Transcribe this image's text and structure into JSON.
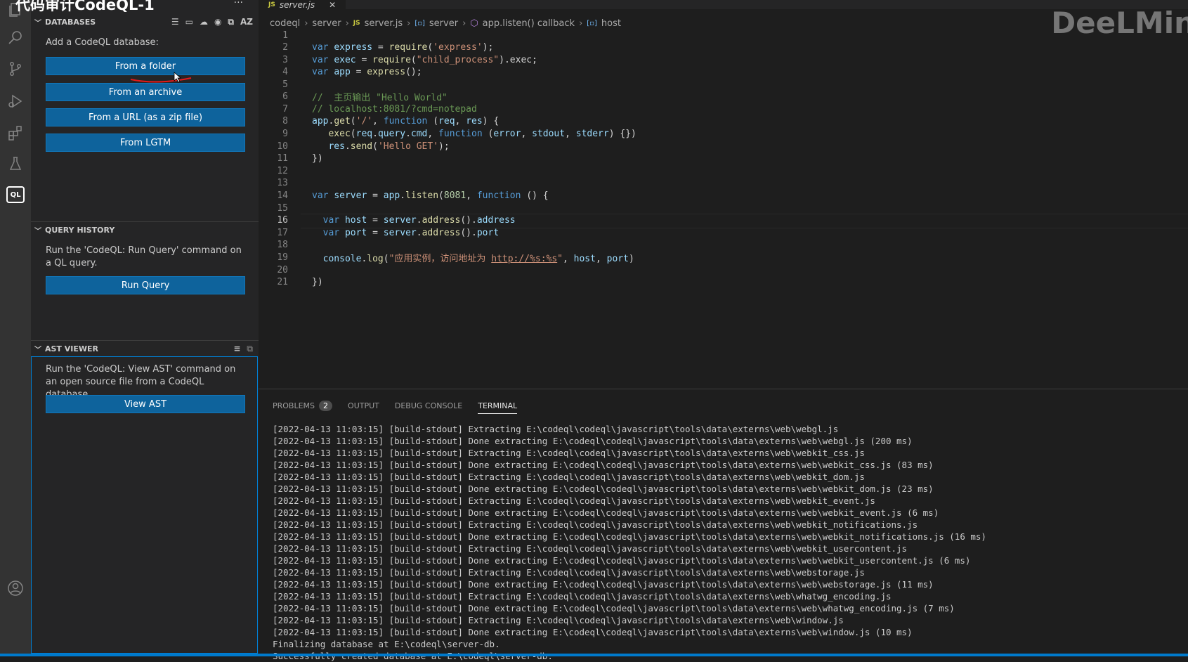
{
  "overlay_title": "代码审计CodeQL-1",
  "watermark": "DeeLMin",
  "activity_bar": {
    "icons": [
      "explorer-icon",
      "search-icon",
      "source-control-icon",
      "run-debug-icon",
      "extensions-icon",
      "testing-icon",
      "codeql-icon",
      "account-icon"
    ],
    "codeql_label": "QL"
  },
  "sidebar": {
    "more_actions": "···",
    "databases": {
      "title": "DATABASES",
      "intro": "Add a CodeQL database:",
      "buttons": [
        "From a folder",
        "From an archive",
        "From a URL (as a zip file)",
        "From LGTM"
      ],
      "action_icons": [
        "list-icon",
        "folder-icon",
        "cloud-icon",
        "github-icon",
        "window-icon"
      ],
      "sort_label": "AZ"
    },
    "query_history": {
      "title": "QUERY HISTORY",
      "text": "Run the 'CodeQL: Run Query' command on a QL query.",
      "button": "Run Query"
    },
    "ast_viewer": {
      "title": "AST VIEWER",
      "text": "Run the 'CodeQL: View AST' command on an open source file from a CodeQL database.",
      "button": "View AST"
    }
  },
  "editor": {
    "tab": {
      "icon": "JS",
      "filename": "server.js",
      "close": "✕"
    },
    "breadcrumb": [
      "codeql",
      "server",
      "server.js",
      "server",
      "app.listen() callback",
      "host"
    ],
    "breadcrumb_js": "JS",
    "active_line": 16
  },
  "panel": {
    "tabs": [
      {
        "label": "PROBLEMS",
        "badge": "2"
      },
      {
        "label": "OUTPUT"
      },
      {
        "label": "DEBUG CONSOLE"
      },
      {
        "label": "TERMINAL",
        "active": true
      }
    ],
    "terminal_lines": [
      "[2022-04-13 11:03:15] [build-stdout] Extracting E:\\codeql\\codeql\\javascript\\tools\\data\\externs\\web\\webgl.js",
      "[2022-04-13 11:03:15] [build-stdout] Done extracting E:\\codeql\\codeql\\javascript\\tools\\data\\externs\\web\\webgl.js (200 ms)",
      "[2022-04-13 11:03:15] [build-stdout] Extracting E:\\codeql\\codeql\\javascript\\tools\\data\\externs\\web\\webkit_css.js",
      "[2022-04-13 11:03:15] [build-stdout] Done extracting E:\\codeql\\codeql\\javascript\\tools\\data\\externs\\web\\webkit_css.js (83 ms)",
      "[2022-04-13 11:03:15] [build-stdout] Extracting E:\\codeql\\codeql\\javascript\\tools\\data\\externs\\web\\webkit_dom.js",
      "[2022-04-13 11:03:15] [build-stdout] Done extracting E:\\codeql\\codeql\\javascript\\tools\\data\\externs\\web\\webkit_dom.js (23 ms)",
      "[2022-04-13 11:03:15] [build-stdout] Extracting E:\\codeql\\codeql\\javascript\\tools\\data\\externs\\web\\webkit_event.js",
      "[2022-04-13 11:03:15] [build-stdout] Done extracting E:\\codeql\\codeql\\javascript\\tools\\data\\externs\\web\\webkit_event.js (6 ms)",
      "[2022-04-13 11:03:15] [build-stdout] Extracting E:\\codeql\\codeql\\javascript\\tools\\data\\externs\\web\\webkit_notifications.js",
      "[2022-04-13 11:03:15] [build-stdout] Done extracting E:\\codeql\\codeql\\javascript\\tools\\data\\externs\\web\\webkit_notifications.js (16 ms)",
      "[2022-04-13 11:03:15] [build-stdout] Extracting E:\\codeql\\codeql\\javascript\\tools\\data\\externs\\web\\webkit_usercontent.js",
      "[2022-04-13 11:03:15] [build-stdout] Done extracting E:\\codeql\\codeql\\javascript\\tools\\data\\externs\\web\\webkit_usercontent.js (6 ms)",
      "[2022-04-13 11:03:15] [build-stdout] Extracting E:\\codeql\\codeql\\javascript\\tools\\data\\externs\\web\\webstorage.js",
      "[2022-04-13 11:03:15] [build-stdout] Done extracting E:\\codeql\\codeql\\javascript\\tools\\data\\externs\\web\\webstorage.js (11 ms)",
      "[2022-04-13 11:03:15] [build-stdout] Extracting E:\\codeql\\codeql\\javascript\\tools\\data\\externs\\web\\whatwg_encoding.js",
      "[2022-04-13 11:03:15] [build-stdout] Done extracting E:\\codeql\\codeql\\javascript\\tools\\data\\externs\\web\\whatwg_encoding.js (7 ms)",
      "[2022-04-13 11:03:15] [build-stdout] Extracting E:\\codeql\\codeql\\javascript\\tools\\data\\externs\\web\\window.js",
      "[2022-04-13 11:03:15] [build-stdout] Done extracting E:\\codeql\\codeql\\javascript\\tools\\data\\externs\\web\\window.js (10 ms)",
      "Finalizing database at E:\\codeql\\server-db.",
      "Successfully created database at E:\\codeql\\server-db."
    ]
  },
  "code": {
    "line_numbers": [
      "1",
      "2",
      "3",
      "4",
      "5",
      "6",
      "7",
      "8",
      "9",
      "10",
      "11",
      "12",
      "13",
      "14",
      "15",
      "16",
      "17",
      "18",
      "19",
      "20",
      "21"
    ],
    "t": {
      "var": "var",
      "function": "function",
      "express": "express",
      "exec": "exec",
      "app": "app",
      "require": "require",
      "str_express": "'express'",
      "str_child": "\"child_process\"",
      "dot_exec": ".exec;",
      "cmt1": "//  主页输出 \"Hello World\"",
      "cmt2": "// localhost:8081/?cmd=notepad",
      "get": "get",
      "str_slash": "'/'",
      "req": "req",
      "res": "res",
      "query": "query",
      "cmd": "cmd",
      "error": "error",
      "stdout": "stdout",
      "stderr": "stderr",
      "send": "send",
      "str_hello": "'Hello GET'",
      "server": "server",
      "listen": "listen",
      "port_num": "8081",
      "host": "host",
      "port": "port",
      "address": "address",
      "console": "console",
      "log": "log",
      "str_log1": "\"应用实例，访问地址为 ",
      "str_url": "http://%s:%s",
      "str_log2": "\""
    }
  }
}
